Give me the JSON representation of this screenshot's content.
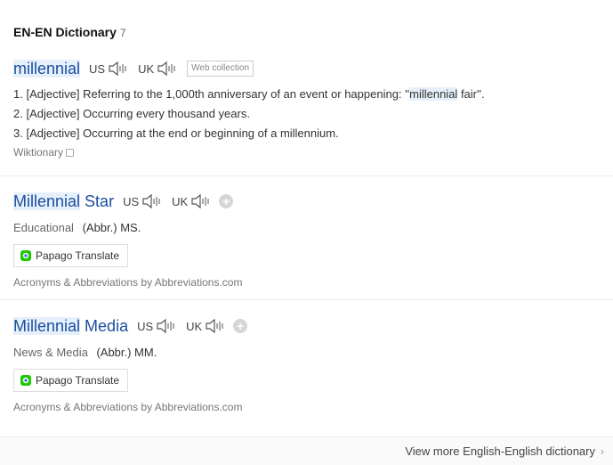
{
  "header": {
    "title": "EN-EN Dictionary",
    "count": "7"
  },
  "entries": [
    {
      "word": "millennial",
      "pron_us": "US",
      "pron_uk": "UK",
      "badge": "Web collection",
      "defs": [
        {
          "num": "1.",
          "pos": "[Adjective]",
          "text_before": "Referring to the 1,000th anniversary of an event or happening: ''",
          "text_hl": "millennial",
          "text_after": " fair''."
        },
        {
          "num": "2.",
          "pos": "[Adjective]",
          "text": "Occurring every thousand years."
        },
        {
          "num": "3.",
          "pos": "[Adjective]",
          "text": "Occurring at the end or beginning of a millennium."
        }
      ],
      "source": "Wiktionary"
    },
    {
      "word_hl": "Millennial",
      "word_rest": " Star",
      "pron_us": "US",
      "pron_uk": "UK",
      "category": "Educational",
      "abbr": "(Abbr.) MS.",
      "papago": "Papago Translate",
      "source": "Acronyms & Abbreviations by Abbreviations.com"
    },
    {
      "word_hl": "Millennial",
      "word_rest": " Media",
      "pron_us": "US",
      "pron_uk": "UK",
      "category": "News & Media",
      "abbr": "(Abbr.) MM.",
      "papago": "Papago Translate",
      "source": "Acronyms & Abbreviations by Abbreviations.com"
    }
  ],
  "footer": {
    "more": "View more English-English dictionary"
  },
  "colors": {
    "link": "#1c4ea0",
    "highlight": "#e6f0fb",
    "papago_green": "#1ec800",
    "papago_blue": "#1d6fe0"
  },
  "icons": {
    "speaker": "speaker-icon",
    "add": "plus-icon",
    "copy": "copy-icon",
    "papago": "papago-logo-icon",
    "chevron": "chevron-right-icon"
  }
}
